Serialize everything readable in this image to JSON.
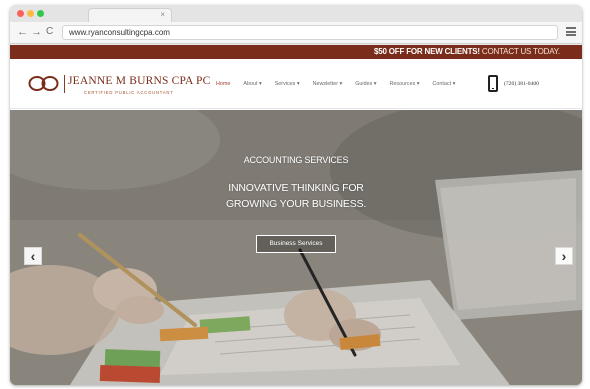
{
  "browser": {
    "tab_close_glyph": "×",
    "back_glyph": "←",
    "forward_glyph": "→",
    "reload_glyph": "C",
    "url": "www.ryanconsultingcpa.com"
  },
  "site": {
    "promo": {
      "highlight": "$50 OFF FOR NEW CLIENTS!",
      "cta": "CONTACT US TODAY."
    },
    "logo": {
      "name": "JEANNE M BURNS CPA PC",
      "subtitle": "CERTIFIED PUBLIC ACCOUNTANT"
    },
    "menu": [
      {
        "label": "Home"
      },
      {
        "label": "About ▾"
      },
      {
        "label": "Services ▾"
      },
      {
        "label": "Newsletter ▾"
      },
      {
        "label": "Guides ▾"
      },
      {
        "label": "Resources ▾"
      },
      {
        "label": "Contact ▾"
      }
    ],
    "phone": "(720) 381-0400",
    "hero": {
      "title": "ACCOUNTING SERVICES",
      "headline_line1": "INNOVATIVE THINKING FOR",
      "headline_line2": "GROWING YOUR BUSINESS.",
      "button": "Business Services",
      "prev_glyph": "‹",
      "next_glyph": "›"
    },
    "colors": {
      "brand": "#7a2d1a",
      "accent": "#a0432b"
    }
  }
}
